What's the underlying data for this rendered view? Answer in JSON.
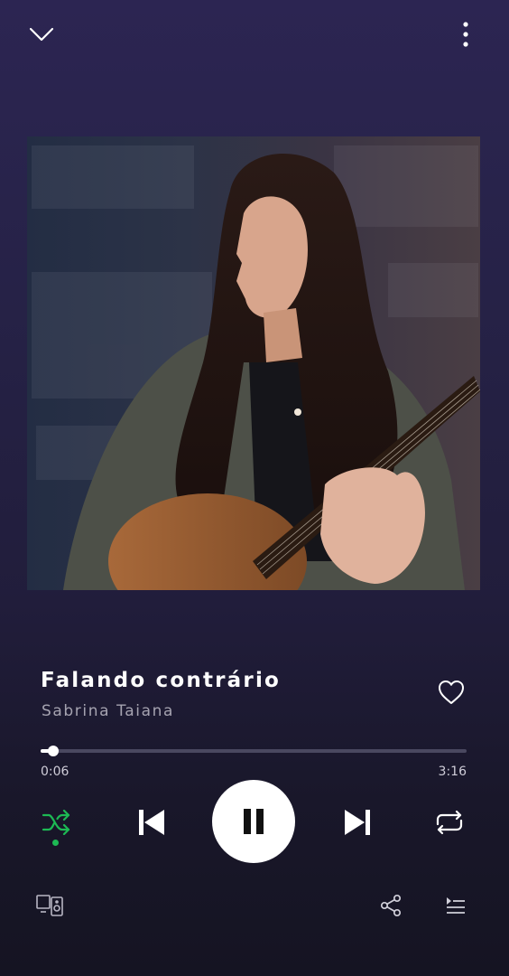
{
  "header": {
    "collapse_icon": "chevron-down-icon",
    "more_icon": "more-vertical-icon"
  },
  "album_art": {
    "description_icon": "album-cover-image"
  },
  "track": {
    "title": "Falando contrário",
    "artist": "Sabrina Taiana",
    "liked": false
  },
  "playback": {
    "elapsed": "0:06",
    "duration": "3:16",
    "progress_fraction": 0.0306,
    "is_playing": true,
    "shuffle_on": true,
    "repeat_on": false
  },
  "footer": {
    "devices_icon": "devices-icon",
    "share_icon": "share-icon",
    "queue_icon": "queue-icon"
  },
  "colors": {
    "accent": "#1db954",
    "background_top": "#2c2552",
    "background_bottom": "#151422",
    "text_primary": "#ffffff",
    "text_secondary": "#a5a3b0"
  }
}
